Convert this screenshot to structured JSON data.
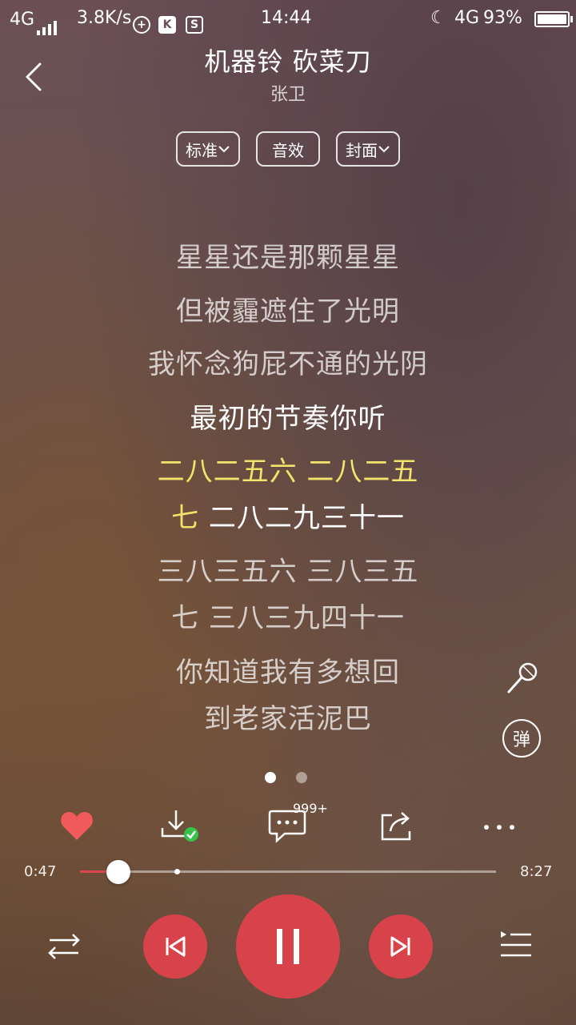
{
  "status_bar": {
    "network_left": "4G",
    "speed": "3.8K/s",
    "time": "14:44",
    "network_right": "4G",
    "battery": "93%"
  },
  "header": {
    "title": "机器铃 砍菜刀",
    "artist": "张卫"
  },
  "options": {
    "quality": "标准",
    "effects": "音效",
    "cover": "封面"
  },
  "lyrics": [
    "星星还是那颗星星",
    "但被霾遮住了光明",
    "我怀念狗屁不通的光阴",
    "最初的节奏你听",
    "二八二五六 二八二五",
    "七 二八二九三十一",
    "三八三五六 三八三五",
    "七 三八三九四十一",
    "你知道我有多想回",
    "到老家活泥巴"
  ],
  "side": {
    "danmaku_label": "弹"
  },
  "actions": {
    "comment_count": "999+"
  },
  "progress": {
    "current": "0:47",
    "total": "8:27",
    "fraction": 0.093
  },
  "colors": {
    "accent": "#d8434b",
    "highlight": "#f2e36a",
    "like": "#f05a5a",
    "download_ok": "#35c24a"
  }
}
